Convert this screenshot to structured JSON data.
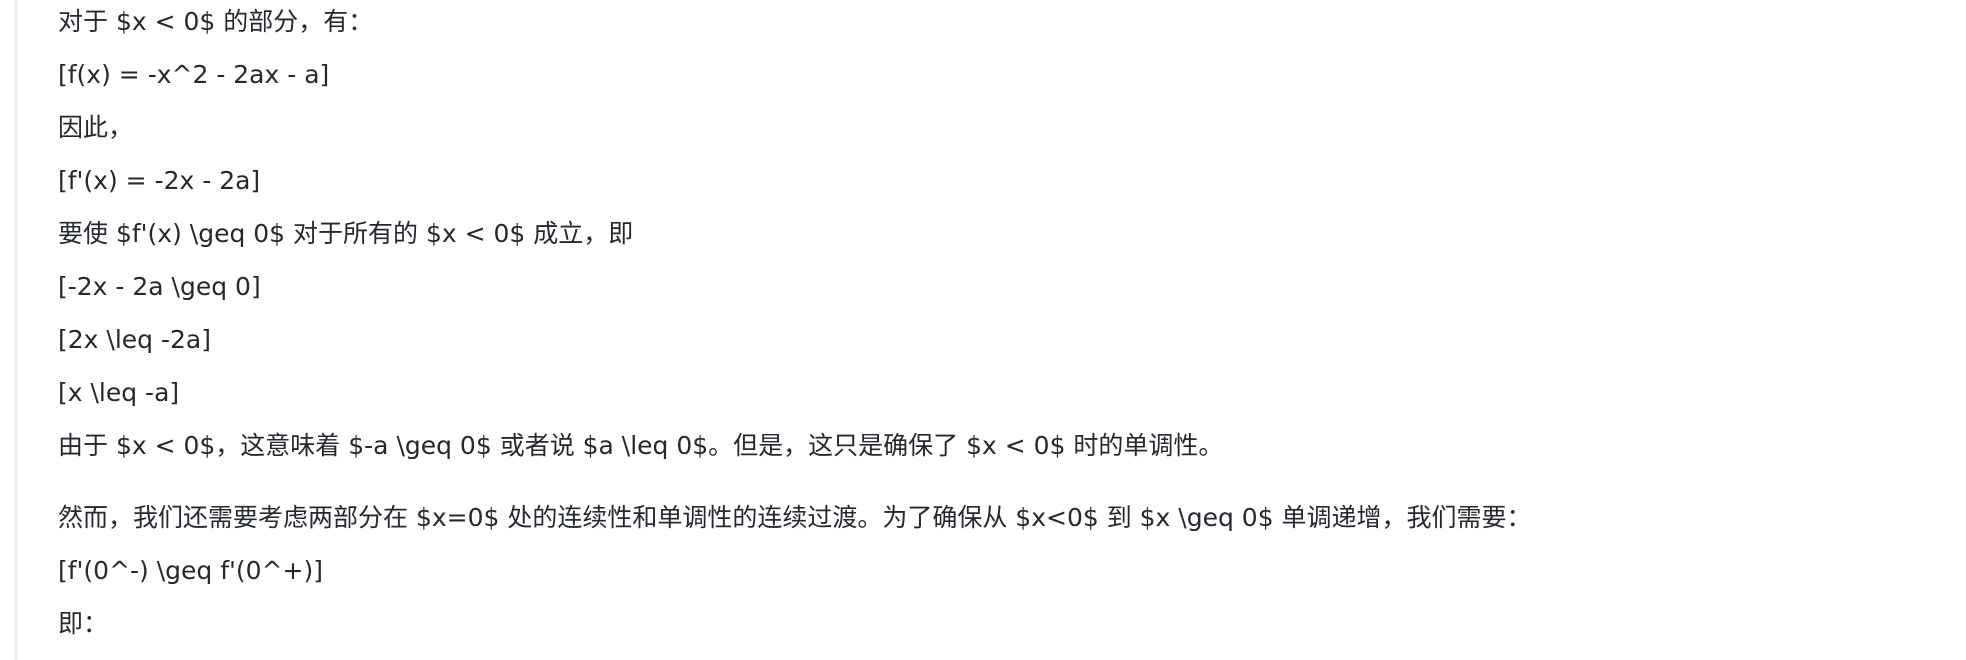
{
  "lines": [
    "对于 $x < 0$ 的部分，有：",
    "[f(x) = -x^2 - 2ax - a]",
    "因此，",
    "[f'(x) = -2x - 2a]",
    "要使 $f'(x) \\geq 0$ 对于所有的 $x < 0$ 成立，即",
    "[-2x - 2a \\geq 0]",
    "[2x \\leq -2a]",
    "[x \\leq -a]",
    "由于 $x < 0$，这意味着 $-a \\geq 0$ 或者说 $a \\leq 0$。但是，这只是确保了 $x < 0$ 时的单调性。",
    "然而，我们还需要考虑两部分在 $x=0$ 处的连续性和单调性的连续过渡。为了确保从 $x<0$ 到 $x \\geq 0$ 单调递增，我们需要：",
    "[f'(0^-) \\geq f'(0^+)]",
    "即："
  ]
}
